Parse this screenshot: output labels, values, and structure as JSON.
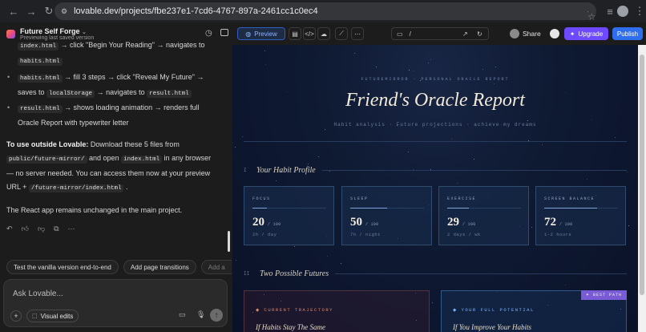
{
  "browser": {
    "url": "lovable.dev/projects/fbe237e1-7cd6-4767-897a-2461cc1c0ec4"
  },
  "project": {
    "name": "Future Self Forge",
    "status": "Previewing last saved version"
  },
  "chat": {
    "line1_code": "index.html",
    "line1_text": "→ click \"Begin Your Reading\" → navigates to",
    "line2_code": "habits.html",
    "bullet2_code": "habits.html",
    "bullet2_text": "→ fill 3 steps → click \"Reveal My Future\" →",
    "bullet2_cont": "saves to",
    "bullet2_code2": "localStorage",
    "bullet2_text2": "→ navigates to",
    "bullet2_code3": "result.html",
    "bullet3_code": "result.html",
    "bullet3_text": "→ shows loading animation → renders full",
    "bullet3_cont": "Oracle Report with typewriter letter",
    "para1_bold": "To use outside Lovable:",
    "para1_a": "Download these 5 files from",
    "para1_code1": "public/future-mirror/",
    "para1_b": "and open",
    "para1_code2": "index.html",
    "para1_c": "in any browser",
    "para1_d": "— no server needed. You can access them now at your preview",
    "para1_e": "URL +",
    "para1_code3": "/future-mirror/index.html",
    "para1_f": ".",
    "para2": "The React app remains unchanged in the main project."
  },
  "suggestions": [
    "Test the vanilla version end-to-end",
    "Add page transitions",
    "Add a"
  ],
  "composer": {
    "placeholder": "Ask Lovable...",
    "add_label": "+",
    "visual_edits_label": "Visual edits"
  },
  "toolbar": {
    "preview_label": "Preview",
    "path_value": "/",
    "share_label": "Share",
    "upgrade_label": "Upgrade",
    "publish_label": "Publish"
  },
  "report": {
    "eyebrow": "FUTUREMIRROR · PERSONAL ORACLE REPORT",
    "title": "Friend's Oracle Report",
    "subtitle": "Habit analysis · Future projections · achieve my dreams",
    "section1_num": "I",
    "section1_title": "Your Habit Profile",
    "section2_num": "II",
    "section2_title": "Two Possible Futures",
    "stats": [
      {
        "label": "FOCUS",
        "value": "20",
        "den": "/ 100",
        "unit": "2h / day",
        "pct": 0.2
      },
      {
        "label": "SLEEP",
        "value": "50",
        "den": "/ 100",
        "unit": "7h / night",
        "pct": 0.5
      },
      {
        "label": "EXERCISE",
        "value": "29",
        "den": "/ 100",
        "unit": "2 days / wk",
        "pct": 0.29
      },
      {
        "label": "SCREEN BALANCE",
        "value": "72",
        "den": "/ 100",
        "unit": "1-2 hours",
        "pct": 0.72
      }
    ],
    "future_left_tag": "◆ CURRENT TRAJECTORY",
    "future_left_title": "If Habits Stay The Same",
    "future_right_tag": "◆ YOUR FULL POTENTIAL",
    "future_right_title": "If You Improve Your Habits",
    "best_path_badge": "✦ BEST PATH"
  },
  "colors": {
    "accent_blue": "#2f6fed",
    "upgrade_purple": "#6d4aff",
    "gold": "#c9a96a"
  }
}
